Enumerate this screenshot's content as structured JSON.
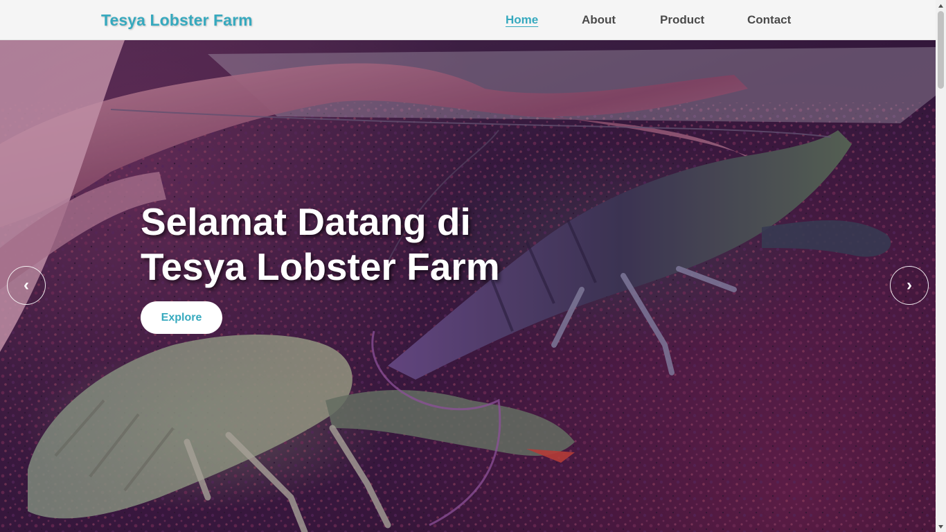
{
  "brand": "Tesya Lobster Farm",
  "nav": {
    "home": "Home",
    "about": "About",
    "product": "Product",
    "contact": "Contact",
    "active": "Home"
  },
  "hero": {
    "title_line1": "Selamat Datang di",
    "title_line2": "Tesya Lobster Farm",
    "button_label": "Explore",
    "prev_icon": "‹",
    "next_icon": "›"
  },
  "colors": {
    "accent": "#36a9be",
    "navbar_bg": "#f5f5f5",
    "nav_text": "#4a4a4a"
  },
  "icons": {
    "prev": "chevron-left-icon",
    "next": "chevron-right-icon"
  }
}
